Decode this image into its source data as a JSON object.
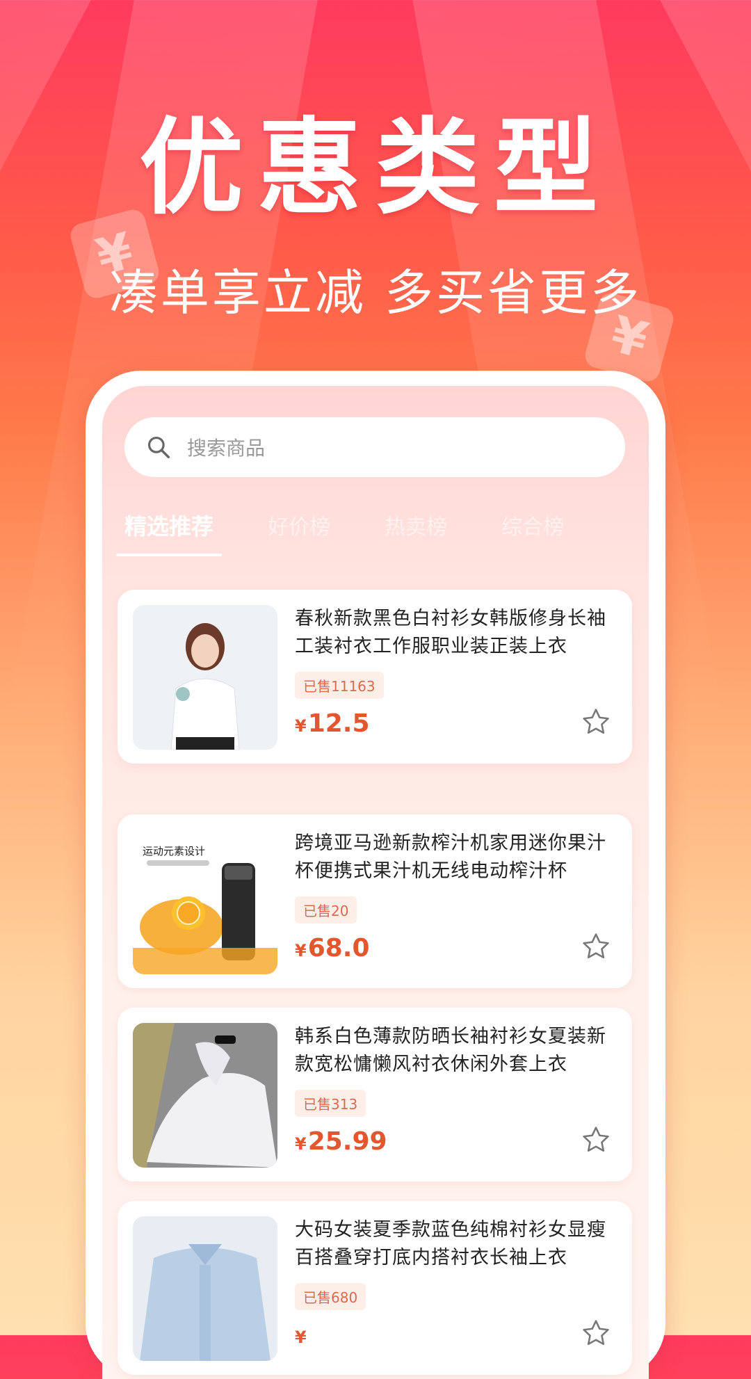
{
  "promo": {
    "headline": "优惠类型",
    "subline": "凑单享立减 多买省更多"
  },
  "search": {
    "placeholder": "搜索商品"
  },
  "tabs": [
    {
      "label": "精选推荐",
      "active": true
    },
    {
      "label": "好价榜",
      "active": false
    },
    {
      "label": "热卖榜",
      "active": false
    },
    {
      "label": "综合榜",
      "active": false
    }
  ],
  "products": [
    {
      "title": "春秋新款黑色白衬衫女韩版修身长袖工装衬衣工作服职业装正装上衣",
      "sold": "已售11163",
      "currency": "¥",
      "price": "12.5"
    },
    {
      "title": "跨境亚马逊新款榨汁机家用迷你果汁杯便携式果汁机无线电动榨汁杯",
      "sold": "已售20",
      "currency": "¥",
      "price": "68.0",
      "image_text": "运动元素设计"
    },
    {
      "title": "韩系白色薄款防晒长袖衬衫女夏装新款宽松慵懒风衬衣休闲外套上衣",
      "sold": "已售313",
      "currency": "¥",
      "price": "25.99"
    },
    {
      "title": "大码女装夏季款蓝色纯棉衬衫女显瘦百搭叠穿打底内搭衬衣长袖上衣",
      "sold": "已售680",
      "currency": "¥",
      "price": ""
    }
  ],
  "colors": {
    "accent": "#e4572e",
    "sold_bg": "#fdeee8",
    "brand_gradient_top": "#ff3a5e"
  }
}
